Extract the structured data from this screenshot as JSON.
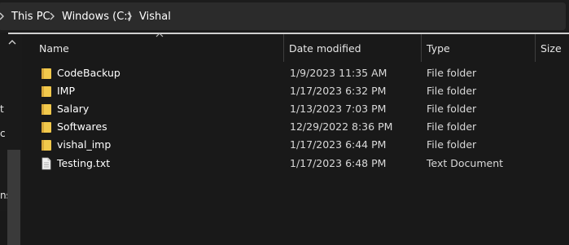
{
  "breadcrumb": {
    "items": [
      "This PC",
      "Windows (C:)",
      "Vishal"
    ]
  },
  "nav_fragments": [
    "t",
    "c",
    "ns"
  ],
  "columns": {
    "name": "Name",
    "date_modified": "Date modified",
    "type": "Type",
    "size": "Size"
  },
  "files": [
    {
      "name": "CodeBackup",
      "date": "1/9/2023 11:35 AM",
      "type": "File folder",
      "size": "",
      "icon": "folder-icon"
    },
    {
      "name": "IMP",
      "date": "1/17/2023 6:32 PM",
      "type": "File folder",
      "size": "",
      "icon": "folder-icon"
    },
    {
      "name": "Salary",
      "date": "1/13/2023 7:03 PM",
      "type": "File folder",
      "size": "",
      "icon": "folder-icon"
    },
    {
      "name": "Softwares",
      "date": "12/29/2022 8:36 PM",
      "type": "File folder",
      "size": "",
      "icon": "folder-icon"
    },
    {
      "name": "vishal_imp",
      "date": "1/17/2023 6:44 PM",
      "type": "File folder",
      "size": "",
      "icon": "folder-icon"
    },
    {
      "name": "Testing.txt",
      "date": "1/17/2023 6:48 PM",
      "type": "Text Document",
      "size": "",
      "icon": "text-file-icon"
    }
  ],
  "colors": {
    "folder": "#f2c94c",
    "background": "#191919",
    "address_bar": "#2b2b2b"
  }
}
